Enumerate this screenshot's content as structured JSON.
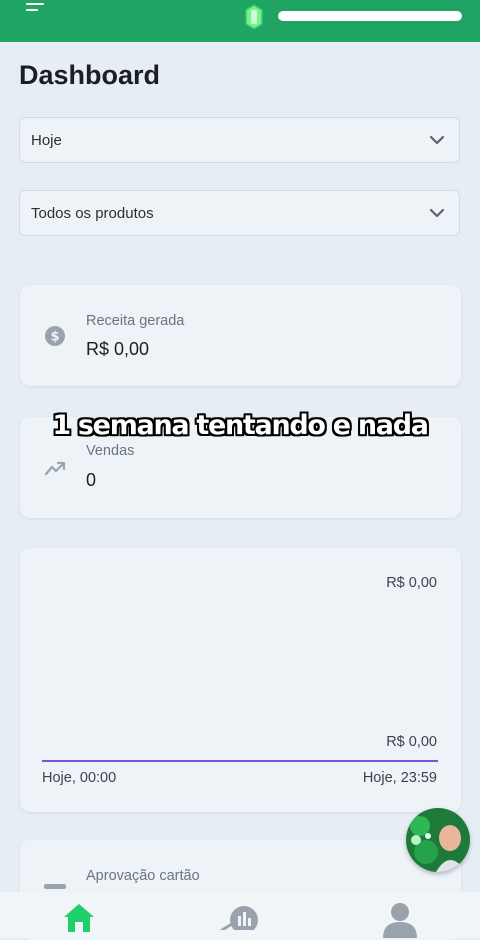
{
  "header": {
    "menu_icon": "hamburger-menu-icon",
    "status_icon": "green-gem-icon",
    "accent_color": "#1fa463"
  },
  "page": {
    "title": "Dashboard"
  },
  "filters": {
    "period": {
      "selected": "Hoje",
      "icon": "chevron-down-icon"
    },
    "product": {
      "selected": "Todos os produtos",
      "icon": "chevron-down-icon"
    }
  },
  "cards": {
    "revenue": {
      "label": "Receita gerada",
      "value": "R$ 0,00",
      "icon": "dollar-coin-icon"
    },
    "sales": {
      "label": "Vendas",
      "value": "0",
      "icon": "trending-up-icon"
    },
    "approval": {
      "label": "Aprovação cartão",
      "icon": "card-icon"
    }
  },
  "overlay_caption": "1 semana tentando e nada",
  "chart": {
    "top_value": "R$ 0,00",
    "bottom_value": "R$ 0,00",
    "x_start": "Hoje, 00:00",
    "x_end": "Hoje, 23:59",
    "line_color": "#7b4fe0"
  },
  "chart_data": {
    "type": "line",
    "x": [
      "Hoje, 00:00",
      "Hoje, 23:59"
    ],
    "series": [
      {
        "values": [
          0,
          0
        ]
      }
    ],
    "ylim": [
      0,
      0
    ],
    "grid": false
  },
  "bottom_nav": {
    "items": [
      {
        "icon": "home-icon",
        "active": true
      },
      {
        "icon": "bar-chart-icon",
        "active": false
      },
      {
        "icon": "user-icon",
        "active": false
      }
    ]
  }
}
